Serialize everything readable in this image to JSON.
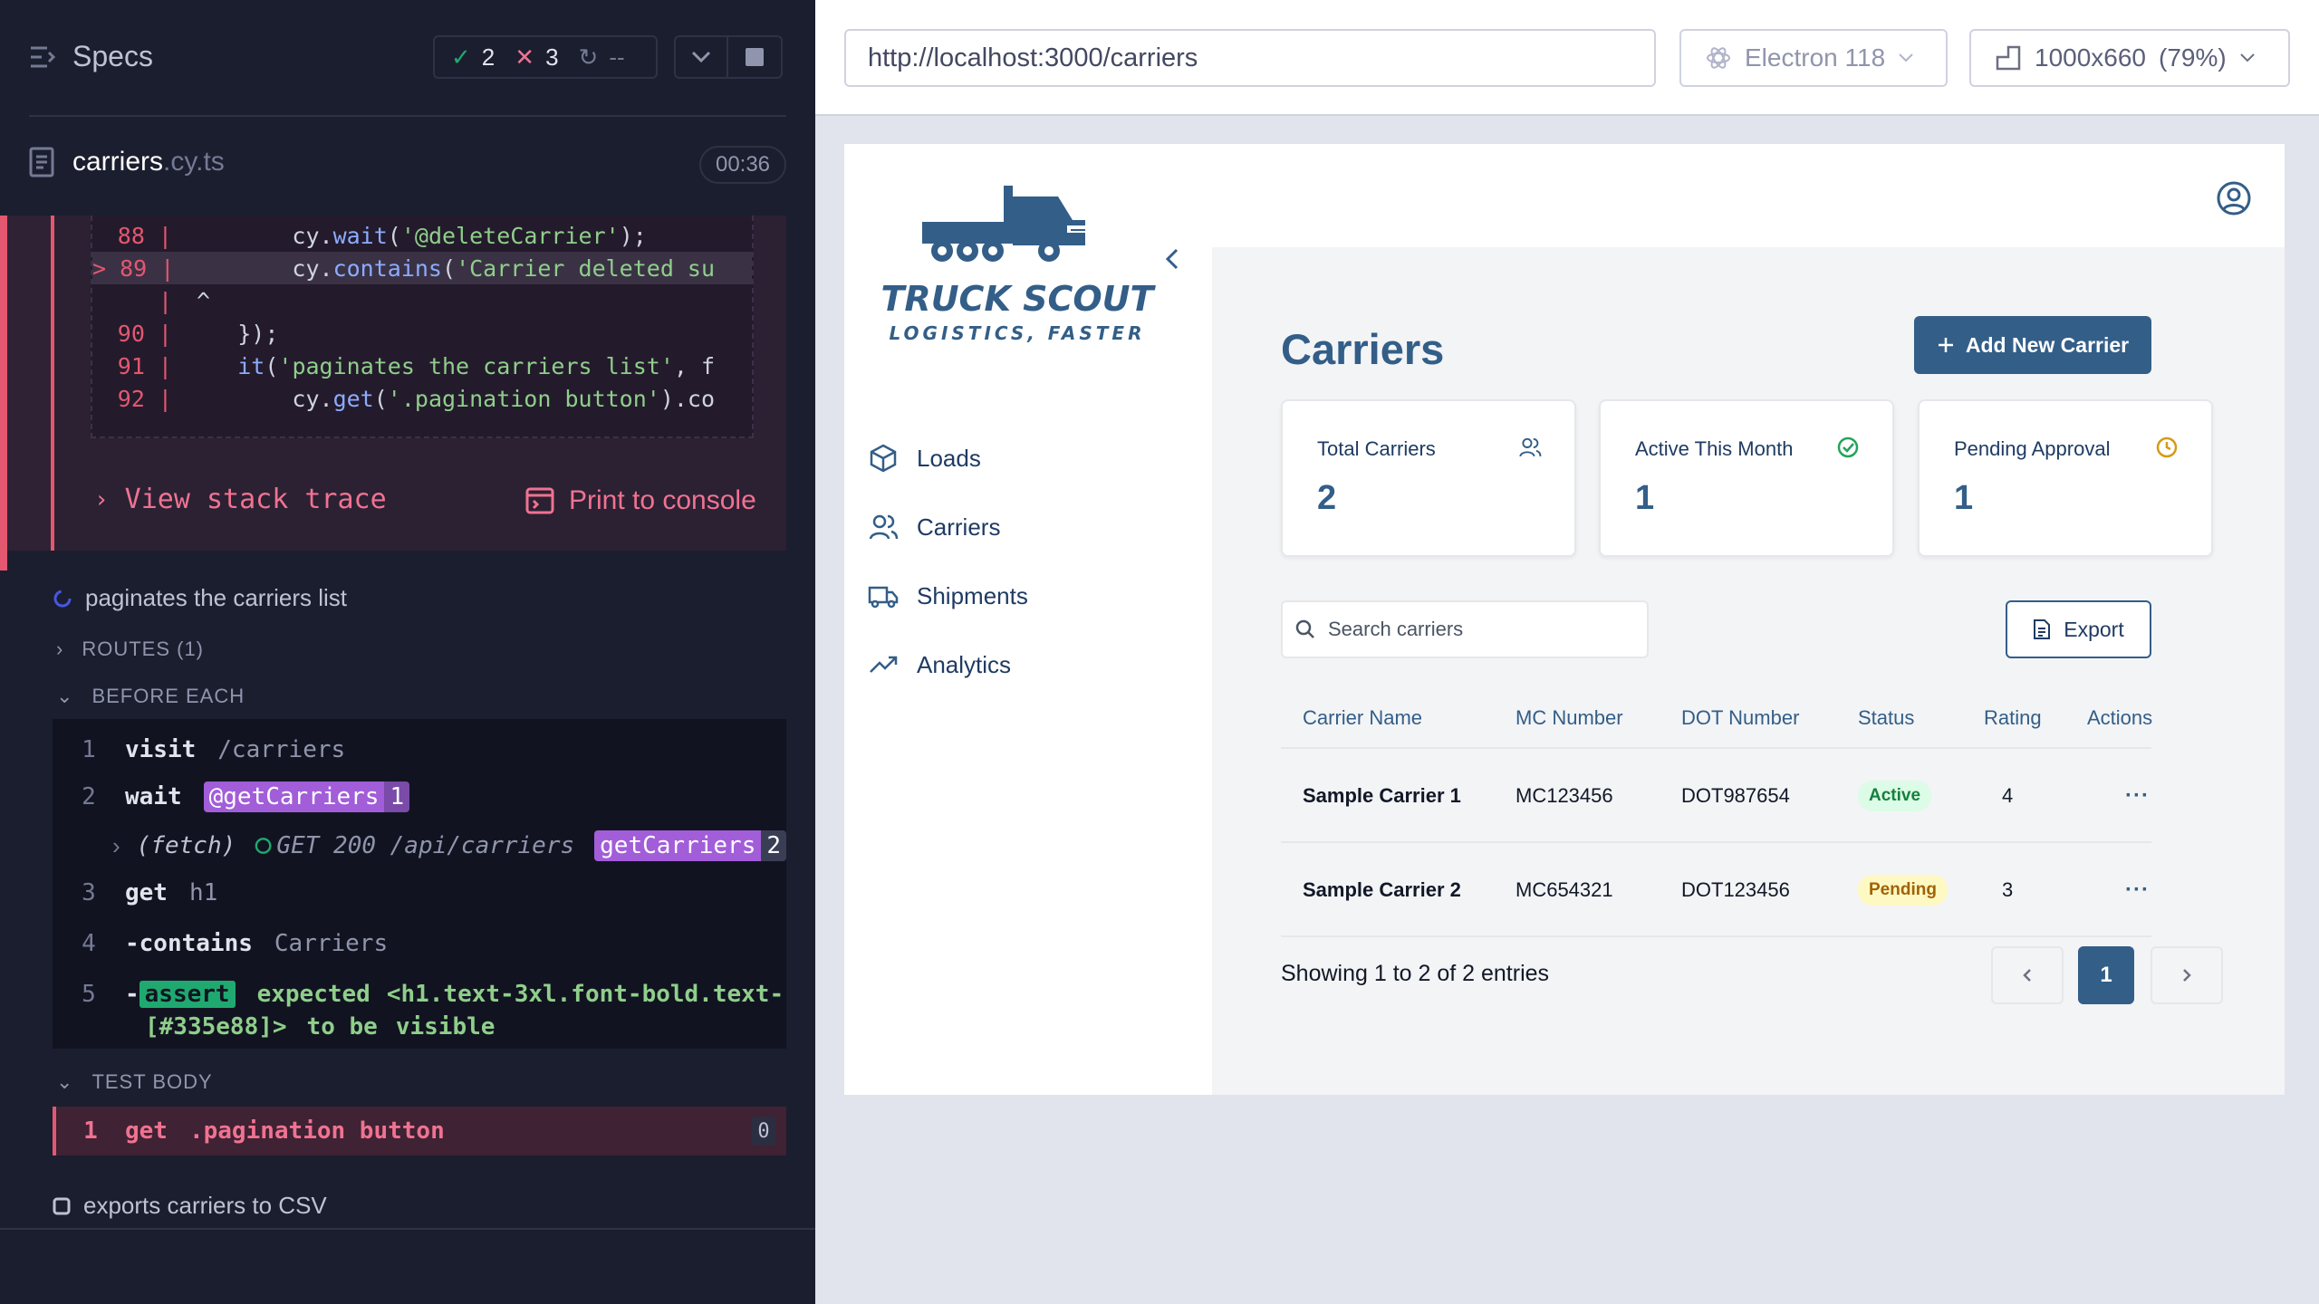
{
  "reporter": {
    "specs_label": "Specs",
    "stats": {
      "passed": "2",
      "failed": "3",
      "pending": "--"
    },
    "spec_file": {
      "name": "carriers",
      "ext": ".cy.ts",
      "timer": "00:36"
    },
    "code_frame": [
      {
        "ln": "88 |",
        "pre": "        ",
        "a": "cy.",
        "b": "wait",
        "c": "(",
        "d": "'@deleteCarrier'",
        "e": ");"
      },
      {
        "ln": "> 89 |",
        "pre": "        ",
        "a": "cy.",
        "b": "contains",
        "c": "(",
        "d": "'Carrier deleted su",
        "e": ""
      },
      {
        "ln": "|",
        "pre": " ^",
        "a": "",
        "b": "",
        "c": "",
        "d": "",
        "e": ""
      },
      {
        "ln": "90 |",
        "pre": "    ",
        "a": "});",
        "b": "",
        "c": "",
        "d": "",
        "e": ""
      },
      {
        "ln": "91 |",
        "pre": "    ",
        "a": "",
        "b": "it",
        "c": "(",
        "d": "'paginates the carriers list'",
        "e": ", f"
      },
      {
        "ln": "92 |",
        "pre": "        ",
        "a": "cy.",
        "b": "get",
        "c": "(",
        "d": "'.pagination button'",
        "e": ").co"
      }
    ],
    "view_stack_trace": "View stack trace",
    "print_to_console": "Print to console",
    "current_test": "paginates the carriers list",
    "routes_label": "ROUTES (1)",
    "before_each_label": "BEFORE EACH",
    "before_each_cmds": [
      {
        "num": "1",
        "name": "visit",
        "msg": "/carriers"
      },
      {
        "num": "2",
        "name": "wait",
        "alias": "@getCarriers",
        "alias_count": "1"
      },
      {
        "num": "",
        "name": "(fetch)",
        "msg": "GET 200 /api/carriers",
        "alias": "getCarriers",
        "alias_count": "2"
      },
      {
        "num": "3",
        "name": "get",
        "msg": "h1"
      },
      {
        "num": "4",
        "name": "-contains",
        "msg": "Carriers"
      },
      {
        "num": "5",
        "name": "-",
        "assert": "assert",
        "expected": "expected",
        "selector": "<h1.text-3xl.font-bold.text-",
        "selector2": "[#335e88]>",
        "to_be": "to be",
        "visible": "visible"
      }
    ],
    "test_body_label": "TEST BODY",
    "test_body_cmd": {
      "num": "1",
      "name": "get",
      "msg": ".pagination button",
      "count": "0"
    },
    "pending_test": "exports carriers to CSV"
  },
  "browser": {
    "url": "http://localhost:3000/carriers",
    "browser_name": "Electron 118",
    "viewport": "1000x660",
    "zoom": "(79%)"
  },
  "app": {
    "logo_title": "TRUCK SCOUT",
    "logo_tagline": "LOGISTICS, FASTER",
    "nav": [
      {
        "label": "Loads",
        "icon": "package-icon"
      },
      {
        "label": "Carriers",
        "icon": "users-icon"
      },
      {
        "label": "Shipments",
        "icon": "truck-icon"
      },
      {
        "label": "Analytics",
        "icon": "trending-up-icon"
      }
    ],
    "page_title": "Carriers",
    "add_button": "Add New Carrier",
    "stats": [
      {
        "label": "Total Carriers",
        "value": "2",
        "icon": "users-icon"
      },
      {
        "label": "Active This Month",
        "value": "1",
        "icon": "check-circle-icon"
      },
      {
        "label": "Pending Approval",
        "value": "1",
        "icon": "clock-icon"
      }
    ],
    "search_placeholder": "Search carriers",
    "export_label": "Export",
    "table": {
      "headers": [
        "Carrier Name",
        "MC Number",
        "DOT Number",
        "Status",
        "Rating",
        "Actions"
      ],
      "rows": [
        {
          "name": "Sample Carrier 1",
          "mc": "MC123456",
          "dot": "DOT987654",
          "status": "Active",
          "rating": "4",
          "actions": "···"
        },
        {
          "name": "Sample Carrier 2",
          "mc": "MC654321",
          "dot": "DOT123456",
          "status": "Pending",
          "rating": "3",
          "actions": "···"
        }
      ]
    },
    "showing": "Showing 1 to 2 of 2 entries",
    "page": "1",
    "colors": {
      "brand": "#335e88",
      "active_bg": "#dcfce7",
      "pending_bg": "#fef9c3"
    }
  }
}
